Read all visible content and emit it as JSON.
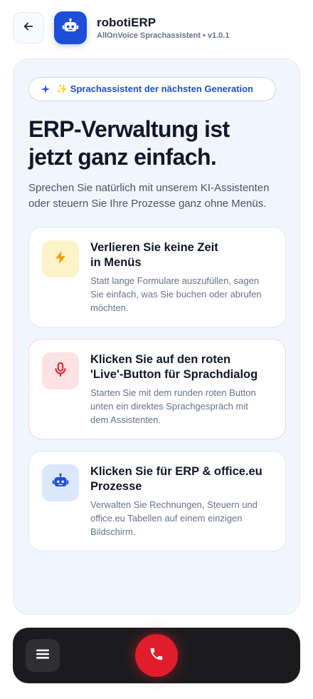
{
  "header": {
    "back_icon": "arrow-left-icon",
    "logo_icon": "robot-icon",
    "title": "robotiERP",
    "subtitle": "AllOnVoice Sprachassistent • v1.0.1"
  },
  "hero": {
    "badge_icon": "sparkle-icon",
    "badge_text": "✨ Sprachassistent der nächsten Generation",
    "title": "ERP-Verwaltung ist\njetzt ganz einfach.",
    "description": "Sprechen Sie natürlich mit unserem KI-Assistenten\noder steuern Sie Ihre Prozesse ganz ohne Menüs."
  },
  "features": [
    {
      "icon": "lightning-icon",
      "title": "Verlieren Sie keine Zeit\nin Menüs",
      "description": "Statt lange Formulare auszufüllen, sagen\nSie einfach, was Sie buchen oder abrufen\nmöchten."
    },
    {
      "icon": "microphone-icon",
      "title": "Klicken Sie auf den roten\n'Live'-Button für Sprachdialog",
      "description": "Starten Sie mit dem runden roten Button\nunten ein direktes Sprachgespräch mit\ndem Assistenten."
    },
    {
      "icon": "robot-icon",
      "title": "Klicken Sie für ERP & office.eu\nProzesse",
      "description": "Verwalten Sie Rechnungen, Steuern und\noffice.eu Tabellen auf einem einzigen\nBildschirm."
    }
  ],
  "bottom_bar": {
    "menu_icon": "menu-icon",
    "call_icon": "phone-icon"
  },
  "colors": {
    "brand_blue": "#1d4ed8",
    "live_red": "#e11d2a",
    "amber": "#f59e0b",
    "panel_bg": "#f1f6fd",
    "bar_bg": "#1b1b1e"
  }
}
